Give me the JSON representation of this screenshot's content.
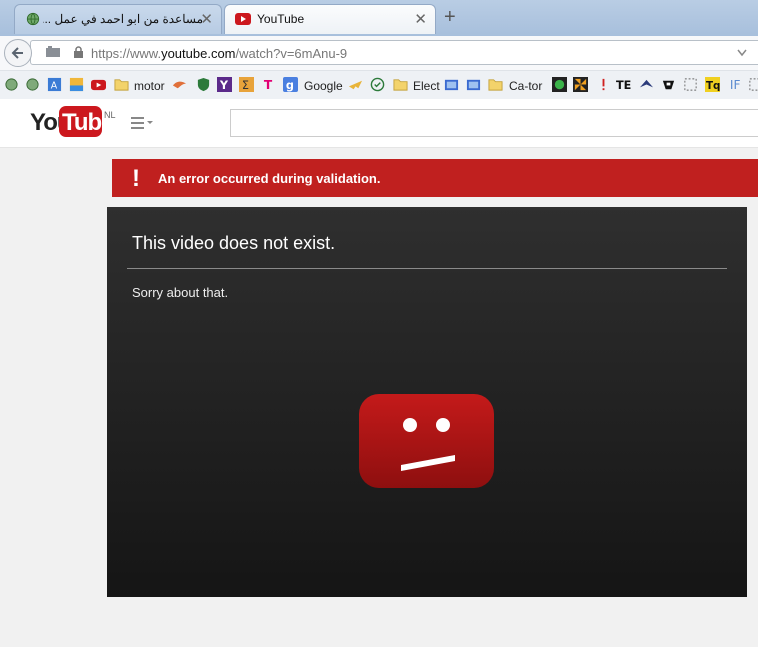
{
  "browser": {
    "tabs": [
      {
        "title": "مساعدة من ابو احمد في عمل ..."
      },
      {
        "title": "YouTube"
      }
    ],
    "new_tab_symbol": "+",
    "close_symbol": "✕",
    "url_prefix": "https://www.",
    "url_domain": "youtube.com",
    "url_suffix": "/watch?v=6mAnu-9",
    "bookmarks": [
      "motor",
      "Google",
      "Elect",
      "Ca-tor"
    ]
  },
  "youtube": {
    "logo_you": "You",
    "logo_tube": "Tube",
    "logo_region": "NL",
    "brand_red": "#cc181e"
  },
  "error": {
    "icon": "!",
    "message": "An error occurred during validation."
  },
  "player": {
    "title": "This video does not exist.",
    "subtitle": "Sorry about that."
  }
}
